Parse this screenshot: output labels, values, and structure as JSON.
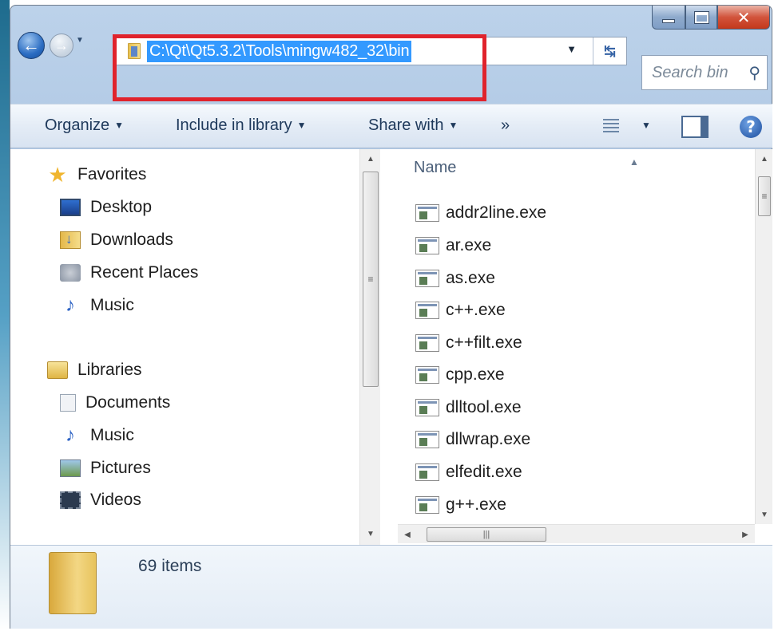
{
  "address": {
    "path": "C:\\Qt\\Qt5.3.2\\Tools\\mingw482_32\\bin"
  },
  "search": {
    "placeholder": "Search bin"
  },
  "toolbar": {
    "organize": "Organize",
    "include_in_library": "Include in library",
    "share_with": "Share with",
    "more": "»"
  },
  "nav": {
    "favorites_header": "Favorites",
    "favorites": [
      "Desktop",
      "Downloads",
      "Recent Places",
      "Music"
    ],
    "libraries_header": "Libraries",
    "libraries": [
      "Documents",
      "Music",
      "Pictures",
      "Videos"
    ]
  },
  "files": {
    "column_name": "Name",
    "items": [
      "addr2line.exe",
      "ar.exe",
      "as.exe",
      "c++.exe",
      "c++filt.exe",
      "cpp.exe",
      "dlltool.exe",
      "dllwrap.exe",
      "elfedit.exe",
      "g++.exe"
    ]
  },
  "status": {
    "item_count": "69 items"
  },
  "colors": {
    "highlight_border": "#e0232c",
    "selection": "#3399ff"
  }
}
